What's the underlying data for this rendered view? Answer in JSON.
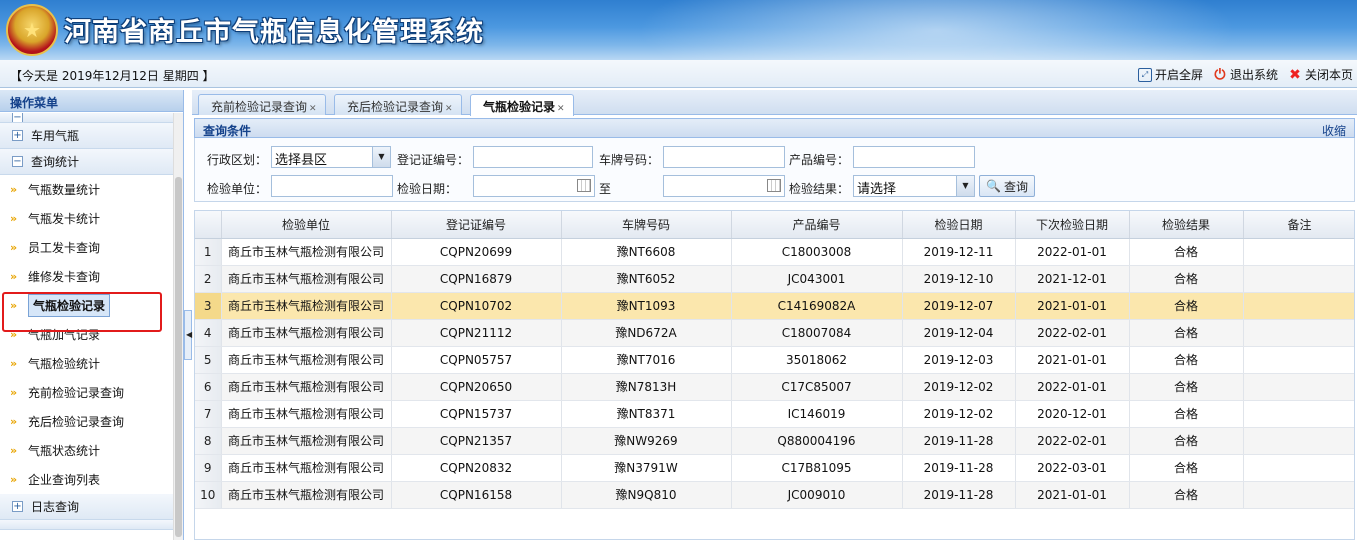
{
  "header": {
    "title": "河南省商丘市气瓶信息化管理系统",
    "emblem_icon": "national-emblem"
  },
  "infobar": {
    "today": "【今天是 2019年12月12日 星期四 】",
    "buttons": [
      {
        "label": "开启全屏",
        "icon": "fullscreen-icon"
      },
      {
        "label": "退出系统",
        "icon": "power-icon"
      },
      {
        "label": "关闭本页",
        "icon": "close-icon"
      }
    ]
  },
  "sidebar": {
    "title": "操作菜单",
    "groups": {
      "vehicle": "车用气瓶",
      "query": "查询统计",
      "log": "日志查询"
    },
    "items": [
      "气瓶数量统计",
      "气瓶发卡统计",
      "员工发卡查询",
      "维修发卡查询",
      "气瓶检验记录",
      "气瓶加气记录",
      "气瓶检验统计",
      "充前检验记录查询",
      "充后检验记录查询",
      "气瓶状态统计",
      "企业查询列表"
    ]
  },
  "tabs": [
    {
      "label": "充前检验记录查询"
    },
    {
      "label": "充后检验记录查询"
    },
    {
      "label": "气瓶检验记录"
    }
  ],
  "query": {
    "title": "查询条件",
    "collapse": "收缩",
    "labels": {
      "region": "行政区划：",
      "cert_no": "登记证编号：",
      "plate_no": "车牌号码：",
      "product_no": "产品编号：",
      "inspect_unit": "检验单位：",
      "inspect_date": "检验日期：",
      "to": "至",
      "result": "检验结果："
    },
    "region_value": "选择县区",
    "result_value": "请选择",
    "search_button": "查询"
  },
  "table": {
    "columns": [
      "",
      "检验单位",
      "登记证编号",
      "车牌号码",
      "产品编号",
      "检验日期",
      "下次检验日期",
      "检验结果",
      "备注"
    ],
    "rows": [
      [
        "1",
        "商丘市玉林气瓶检测有限公司",
        "CQPN20699",
        "豫NT6608",
        "C18003008",
        "2019-12-11",
        "2022-01-01",
        "合格",
        ""
      ],
      [
        "2",
        "商丘市玉林气瓶检测有限公司",
        "CQPN16879",
        "豫NT6052",
        "JC043001",
        "2019-12-10",
        "2021-12-01",
        "合格",
        ""
      ],
      [
        "3",
        "商丘市玉林气瓶检测有限公司",
        "CQPN10702",
        "豫NT1093",
        "C14169082A",
        "2019-12-07",
        "2021-01-01",
        "合格",
        ""
      ],
      [
        "4",
        "商丘市玉林气瓶检测有限公司",
        "CQPN21112",
        "豫ND672A",
        "C18007084",
        "2019-12-04",
        "2022-02-01",
        "合格",
        ""
      ],
      [
        "5",
        "商丘市玉林气瓶检测有限公司",
        "CQPN05757",
        "豫NT7016",
        "35018062",
        "2019-12-03",
        "2021-01-01",
        "合格",
        ""
      ],
      [
        "6",
        "商丘市玉林气瓶检测有限公司",
        "CQPN20650",
        "豫N7813H",
        "C17C85007",
        "2019-12-02",
        "2022-01-01",
        "合格",
        ""
      ],
      [
        "7",
        "商丘市玉林气瓶检测有限公司",
        "CQPN15737",
        "豫NT8371",
        "IC146019",
        "2019-12-02",
        "2020-12-01",
        "合格",
        ""
      ],
      [
        "8",
        "商丘市玉林气瓶检测有限公司",
        "CQPN21357",
        "豫NW9269",
        "Q880004196",
        "2019-11-28",
        "2022-02-01",
        "合格",
        ""
      ],
      [
        "9",
        "商丘市玉林气瓶检测有限公司",
        "CQPN20832",
        "豫N3791W",
        "C17B81095",
        "2019-11-28",
        "2022-03-01",
        "合格",
        ""
      ],
      [
        "10",
        "商丘市玉林气瓶检测有限公司",
        "CQPN16158",
        "豫N9Q810",
        "JC009010",
        "2019-11-28",
        "2021-01-01",
        "合格",
        ""
      ]
    ]
  },
  "colors": {
    "accent": "#15428b",
    "selected_row": "#fbe7ad",
    "highlight_border": "#e21b1b"
  }
}
